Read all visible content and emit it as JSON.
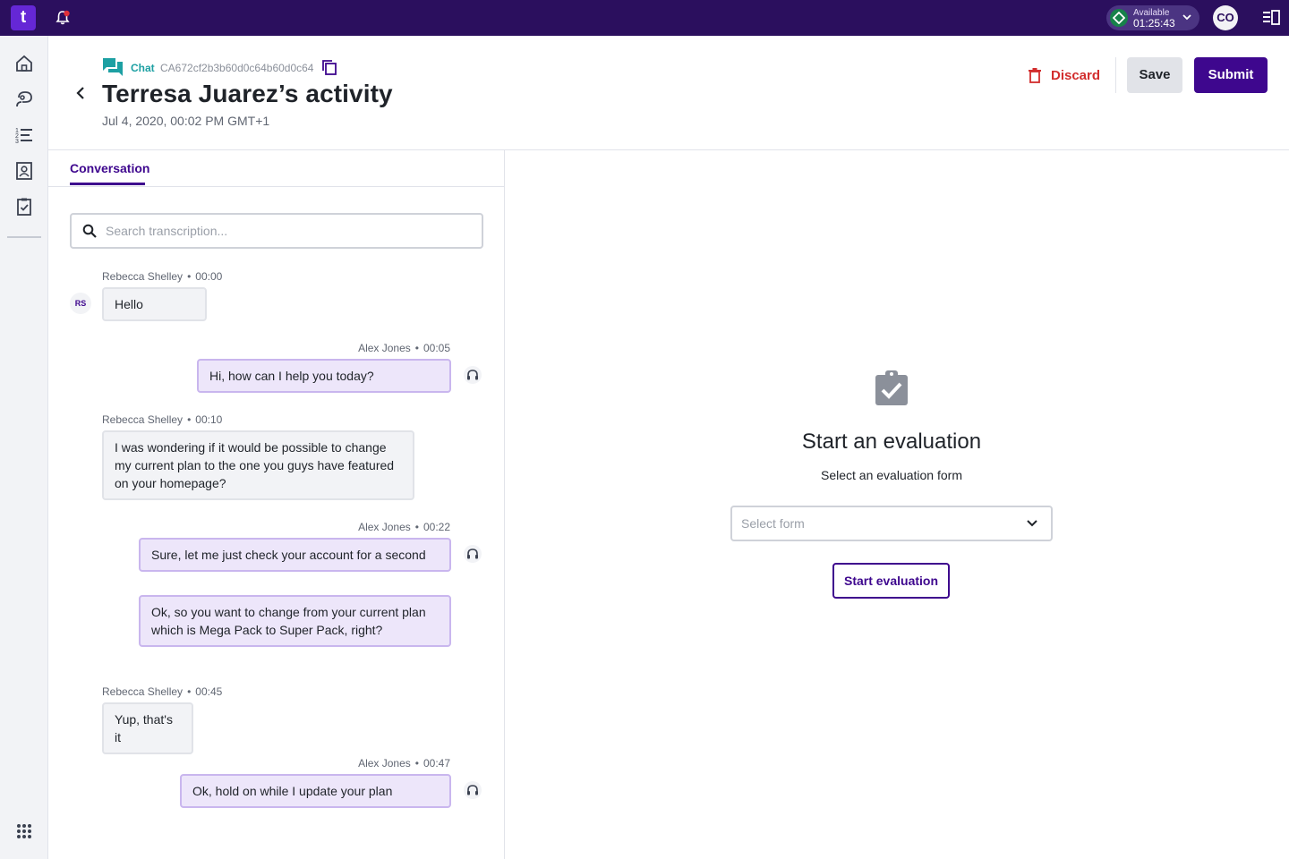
{
  "topbar": {
    "logo_text": "t",
    "status_label": "Available",
    "status_timer": "01:25:43",
    "user_initials": "CO",
    "status_color": "#17824a",
    "bar_color": "#2b0f5e"
  },
  "leftnav": {
    "items": [
      {
        "name": "home-icon"
      },
      {
        "name": "agent-icon"
      },
      {
        "name": "queue-list-icon"
      },
      {
        "name": "contacts-icon"
      },
      {
        "name": "evaluation-icon"
      }
    ],
    "bottom": {
      "name": "apps-grid-icon"
    }
  },
  "header": {
    "channel_label": "Chat",
    "activity_id": "CA672cf2b3b60d0c64b60d0c64",
    "title": "Terresa Juarez’s activity",
    "date": "Jul 4, 2020, 00:02 PM GMT+1",
    "discard_label": "Discard",
    "save_label": "Save",
    "submit_label": "Submit"
  },
  "conversation": {
    "tab_label": "Conversation",
    "search_placeholder": "Search transcription...",
    "customer_initials": "RS",
    "messages": [
      {
        "author": "Rebecca Shelley",
        "time": "00:00",
        "text": "Hello",
        "direction": "in"
      },
      {
        "author": "Alex Jones",
        "time": "00:05",
        "text": "Hi, how can I help you today?",
        "direction": "out"
      },
      {
        "author": "Rebecca Shelley",
        "time": "00:10",
        "text": "I was wondering if it would be possible to change my current plan to the one you guys have featured on your homepage?",
        "direction": "in"
      },
      {
        "author": "Alex Jones",
        "time": "00:22",
        "text": "Sure, let me just check your account for a second",
        "direction": "out"
      },
      {
        "author": "",
        "time": "",
        "text": "Ok, so you want to change from your current plan which is Mega Pack to Super Pack, right?",
        "direction": "out"
      },
      {
        "author": "Rebecca Shelley",
        "time": "00:45",
        "text": "Yup, that's it",
        "direction": "in"
      },
      {
        "author": "Alex Jones",
        "time": "00:47",
        "text": "Ok, hold on while I update your plan",
        "direction": "out"
      }
    ]
  },
  "evaluation": {
    "title": "Start an evaluation",
    "subtitle": "Select an evaluation form",
    "select_placeholder": "Select form",
    "start_label": "Start evaluation"
  },
  "colors": {
    "accent": "#3e078e",
    "danger": "#d22d2d",
    "chat_teal": "#1da0a3",
    "bubble_out": "#ede6fa",
    "bubble_in": "#f2f3f6"
  }
}
